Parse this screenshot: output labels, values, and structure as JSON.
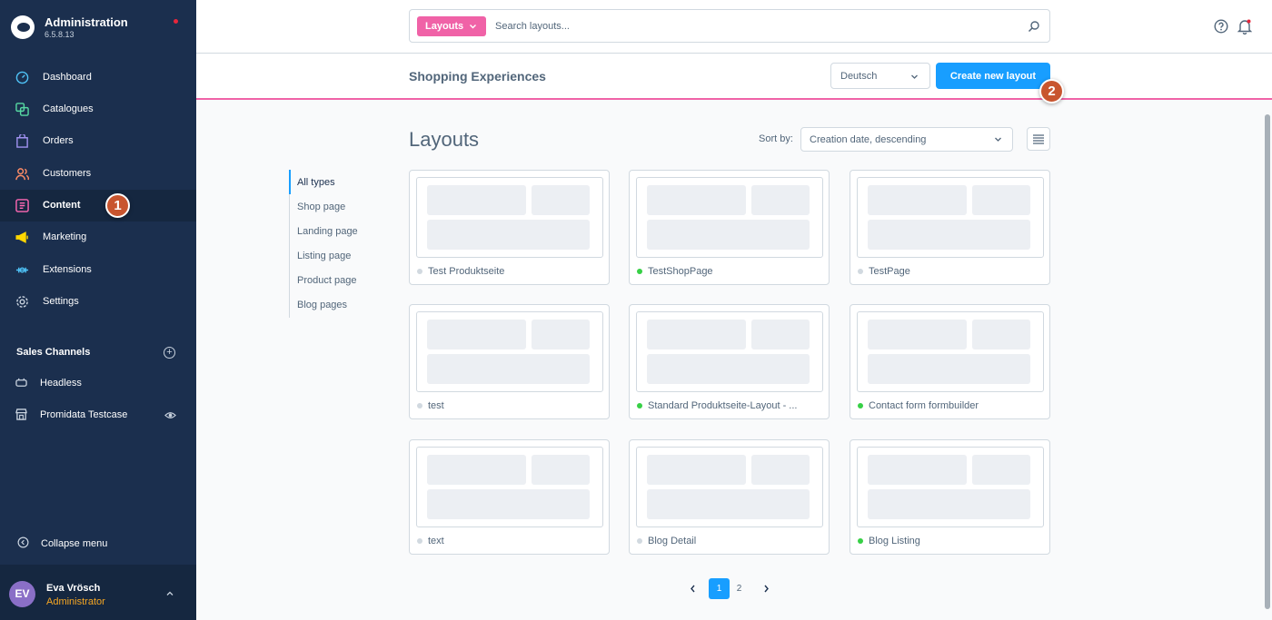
{
  "brand": {
    "title": "Administration",
    "version": "6.5.8.13"
  },
  "nav": [
    {
      "label": "Dashboard",
      "icon": "dashboard-icon"
    },
    {
      "label": "Catalogues",
      "icon": "catalogue-icon"
    },
    {
      "label": "Orders",
      "icon": "orders-icon"
    },
    {
      "label": "Customers",
      "icon": "customers-icon"
    },
    {
      "label": "Content",
      "icon": "content-icon",
      "active": true
    },
    {
      "label": "Marketing",
      "icon": "marketing-icon"
    },
    {
      "label": "Extensions",
      "icon": "extensions-icon"
    },
    {
      "label": "Settings",
      "icon": "settings-icon"
    }
  ],
  "sales_channels": {
    "heading": "Sales Channels",
    "items": [
      {
        "label": "Headless",
        "icon": "headless-icon"
      },
      {
        "label": "Promidata Testcase",
        "icon": "storefront-icon"
      }
    ]
  },
  "collapse_label": "Collapse menu",
  "user": {
    "initials": "EV",
    "name": "Eva Vrösch",
    "role": "Administrator"
  },
  "badges": {
    "step1": "1",
    "step2": "2"
  },
  "search": {
    "type_label": "Layouts",
    "placeholder": "Search layouts..."
  },
  "header": {
    "title": "Shopping Experiences",
    "language": "Deutsch",
    "create_label": "Create new layout"
  },
  "listing": {
    "title": "Layouts",
    "sort_label": "Sort by:",
    "sort_value": "Creation date, descending"
  },
  "filters": [
    "All types",
    "Shop page",
    "Landing page",
    "Listing page",
    "Product page",
    "Blog pages"
  ],
  "layouts": [
    {
      "name": "Test Produktseite",
      "active": false
    },
    {
      "name": "TestShopPage",
      "active": true
    },
    {
      "name": "TestPage",
      "active": false
    },
    {
      "name": "test",
      "active": false
    },
    {
      "name": "Standard Produktseite-Layout - ...",
      "active": true
    },
    {
      "name": "Contact form formbuilder",
      "active": true
    },
    {
      "name": "text",
      "active": false
    },
    {
      "name": "Blog Detail",
      "active": false
    },
    {
      "name": "Blog Listing",
      "active": true
    }
  ],
  "pagination": {
    "pages": [
      "1",
      "2"
    ],
    "current": "1"
  },
  "colors": {
    "sidebar": "#1b2f4e",
    "accent": "#189eff",
    "pink": "#f062a7",
    "active_status": "#37d046",
    "badge": "#c8552f"
  }
}
